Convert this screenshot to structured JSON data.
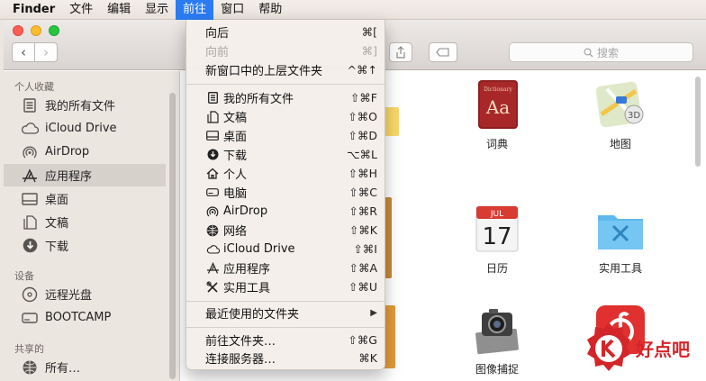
{
  "menubar": {
    "items": [
      {
        "label": "Finder"
      },
      {
        "label": "文件"
      },
      {
        "label": "编辑"
      },
      {
        "label": "显示"
      },
      {
        "label": "前往"
      },
      {
        "label": "窗口"
      },
      {
        "label": "帮助"
      }
    ],
    "active_index": 4
  },
  "toolbar": {
    "search_placeholder": "搜索"
  },
  "sidebar": {
    "sections": [
      {
        "heading": "个人收藏",
        "items": [
          {
            "label": "我的所有文件",
            "icon": "all-files-icon"
          },
          {
            "label": "iCloud Drive",
            "icon": "cloud-icon"
          },
          {
            "label": "AirDrop",
            "icon": "airdrop-icon"
          },
          {
            "label": "应用程序",
            "icon": "applications-icon",
            "selected": true
          },
          {
            "label": "桌面",
            "icon": "desktop-icon"
          },
          {
            "label": "文稿",
            "icon": "documents-icon"
          },
          {
            "label": "下载",
            "icon": "download-icon"
          }
        ]
      },
      {
        "heading": "设备",
        "items": [
          {
            "label": "远程光盘",
            "icon": "disc-icon"
          },
          {
            "label": "BOOTCAMP",
            "icon": "drive-icon"
          }
        ]
      },
      {
        "heading": "共享的",
        "items": [
          {
            "label": "所有…",
            "icon": "network-icon"
          }
        ]
      }
    ]
  },
  "content": {
    "apps": [
      {
        "label": "词典",
        "icon": "dictionary-icon"
      },
      {
        "label": "地图",
        "icon": "maps-icon"
      },
      {
        "label": "日历",
        "icon": "calendar-icon",
        "calendar_month": "JUL",
        "calendar_day": "17"
      },
      {
        "label": "实用工具",
        "icon": "utilities-folder-icon"
      },
      {
        "label": "图像捕捉",
        "icon": "image-capture-icon"
      },
      {
        "label": "",
        "icon": "netease-music-icon"
      }
    ],
    "dictionary_cover_text": "Aa",
    "dictionary_cover_title": "Dictionary"
  },
  "go_menu": {
    "groups": [
      [
        {
          "label": "向后",
          "shortcut": "⌘[",
          "disabled": false
        },
        {
          "label": "向前",
          "shortcut": "⌘]",
          "disabled": true
        },
        {
          "label": "新窗口中的上层文件夹",
          "shortcut": "^⌘↑",
          "disabled": false
        }
      ],
      [
        {
          "label": "我的所有文件",
          "shortcut": "⇧⌘F",
          "icon": "all-files-icon"
        },
        {
          "label": "文稿",
          "shortcut": "⇧⌘O",
          "icon": "documents-icon"
        },
        {
          "label": "桌面",
          "shortcut": "⇧⌘D",
          "icon": "desktop-icon"
        },
        {
          "label": "下载",
          "shortcut": "⌥⌘L",
          "icon": "download-icon"
        },
        {
          "label": "个人",
          "shortcut": "⇧⌘H",
          "icon": "home-icon"
        },
        {
          "label": "电脑",
          "shortcut": "⇧⌘C",
          "icon": "computer-icon"
        },
        {
          "label": "AirDrop",
          "shortcut": "⇧⌘R",
          "icon": "airdrop-icon"
        },
        {
          "label": "网络",
          "shortcut": "⇧⌘K",
          "icon": "network-icon"
        },
        {
          "label": "iCloud Drive",
          "shortcut": "⇧⌘I",
          "icon": "cloud-icon"
        },
        {
          "label": "应用程序",
          "shortcut": "⇧⌘A",
          "icon": "applications-icon"
        },
        {
          "label": "实用工具",
          "shortcut": "⇧⌘U",
          "icon": "utilities-icon"
        }
      ],
      [
        {
          "label": "最近使用的文件夹",
          "shortcut": "▶",
          "submenu": true
        }
      ],
      [
        {
          "label": "前往文件夹…",
          "shortcut": "⇧⌘G"
        },
        {
          "label": "连接服务器…",
          "shortcut": "⌘K"
        }
      ]
    ]
  },
  "watermark": {
    "text": "好点吧",
    "brand_color": "#d4252a"
  },
  "colors": {
    "accent": "#2b7bf2",
    "sidebar_bg": "#ece6e0",
    "menu_bg": "#f4efeb"
  }
}
